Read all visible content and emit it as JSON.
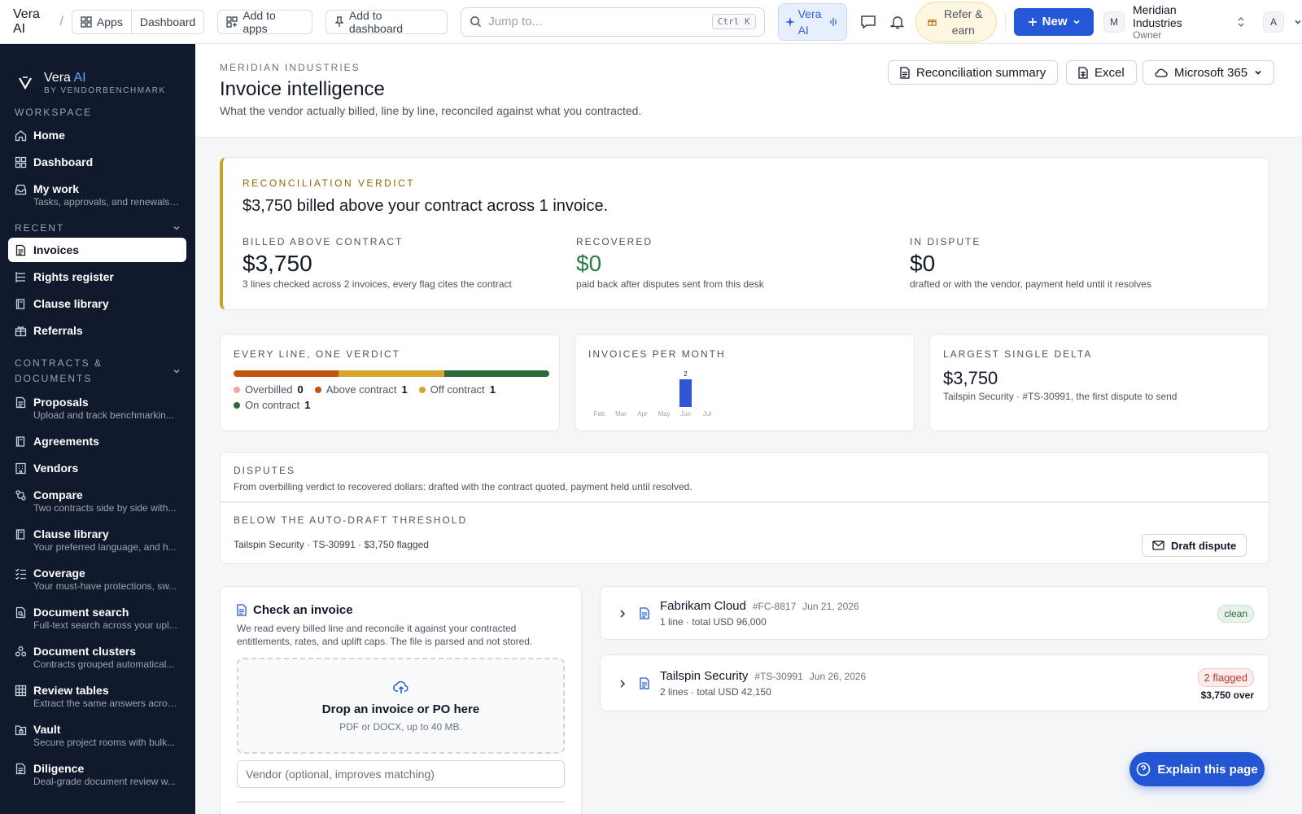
{
  "topbar": {
    "brand": "Vera AI",
    "apps": "Apps",
    "dashboard": "Dashboard",
    "add_to_apps": "Add to apps",
    "add_to_dashboard": "Add to dashboard",
    "search_placeholder": "Jump to...",
    "search_shortcut": "Ctrl K",
    "vera_ai": "Vera AI",
    "refer": "Refer & earn",
    "new": "New",
    "org_initial": "M",
    "org_name": "Meridian Industries",
    "org_role": "Owner",
    "user_initial": "A"
  },
  "sidebar": {
    "logo_title": "Vera",
    "logo_ai": "AI",
    "logo_sub": "BY VENDORBENCHMARK",
    "workspace_label": "WORKSPACE",
    "recent_label": "RECENT",
    "contracts_label_1": "CONTRACTS &",
    "contracts_label_2": "DOCUMENTS",
    "workspace": [
      {
        "label": "Home",
        "icon": "home-icon"
      },
      {
        "label": "Dashboard",
        "icon": "grid-icon"
      },
      {
        "label": "My work",
        "desc": "Tasks, approvals, and renewals ...",
        "icon": "inbox-icon"
      }
    ],
    "recent": [
      {
        "label": "Invoices",
        "icon": "document-icon",
        "active": true
      },
      {
        "label": "Rights register",
        "icon": "list-icon"
      },
      {
        "label": "Clause library",
        "icon": "book-icon"
      },
      {
        "label": "Referrals",
        "icon": "gift-icon"
      }
    ],
    "contracts": [
      {
        "label": "Proposals",
        "desc": "Upload and track benchmarkin...",
        "icon": "document-icon"
      },
      {
        "label": "Agreements",
        "icon": "book-icon"
      },
      {
        "label": "Vendors",
        "icon": "building-icon"
      },
      {
        "label": "Compare",
        "desc": "Two contracts side by side with...",
        "icon": "compare-icon"
      },
      {
        "label": "Clause library",
        "desc": "Your preferred language, and h...",
        "icon": "book-icon"
      },
      {
        "label": "Coverage",
        "desc": "Your must-have protections, sw...",
        "icon": "checklist-icon"
      },
      {
        "label": "Document search",
        "desc": "Full-text search across your upl...",
        "icon": "doc-search-icon"
      },
      {
        "label": "Document clusters",
        "desc": "Contracts grouped automatical...",
        "icon": "cluster-icon"
      },
      {
        "label": "Review tables",
        "desc": "Extract the same answers acros...",
        "icon": "table-icon"
      },
      {
        "label": "Vault",
        "desc": "Secure project rooms with bulk...",
        "icon": "folder-lock-icon"
      },
      {
        "label": "Diligence",
        "desc": "Deal-grade document review w...",
        "icon": "document-icon"
      }
    ]
  },
  "header": {
    "eyebrow": "MERIDIAN INDUSTRIES",
    "title": "Invoice intelligence",
    "subtitle": "What the vendor actually billed, line by line, reconciled against what you contracted.",
    "btn_summary": "Reconciliation summary",
    "btn_excel": "Excel",
    "btn_m365": "Microsoft 365"
  },
  "verdict": {
    "label": "RECONCILIATION VERDICT",
    "headline": "$3,750 billed above your contract across 1 invoice.",
    "kpis": [
      {
        "label": "BILLED ABOVE CONTRACT",
        "value": "$3,750",
        "desc": "3 lines checked across 2 invoices, every flag cites the contract",
        "color": "#111827"
      },
      {
        "label": "RECOVERED",
        "value": "$0",
        "desc": "paid back after disputes sent from this desk",
        "color": "#2f7a43"
      },
      {
        "label": "IN DISPUTE",
        "value": "$0",
        "desc": "drafted or with the vendor, payment held until it resolves",
        "color": "#111827"
      }
    ]
  },
  "line_verdict": {
    "label": "EVERY LINE, ONE VERDICT",
    "segments": [
      {
        "name": "Overbilled",
        "count": 0,
        "color": "#f2a5a5"
      },
      {
        "name": "Above contract",
        "count": 1,
        "color": "#c2540f"
      },
      {
        "name": "Off contract",
        "count": 1,
        "color": "#d4a72c"
      },
      {
        "name": "On contract",
        "count": 1,
        "color": "#2f6b3a"
      }
    ]
  },
  "per_month": {
    "label": "INVOICES PER MONTH",
    "chart_data": {
      "type": "bar",
      "categories": [
        "Feb",
        "Mar",
        "Apr",
        "May",
        "Jun",
        "Jul"
      ],
      "values": [
        0,
        0,
        0,
        0,
        2,
        0
      ],
      "data_labels": [
        "",
        "",
        "",
        "",
        "2",
        ""
      ],
      "ylim": [
        0,
        2
      ],
      "color": "#2f55d4"
    }
  },
  "largest": {
    "label": "LARGEST SINGLE DELTA",
    "value": "$3,750",
    "desc": "Tailspin Security · #TS-30991, the first dispute to send"
  },
  "disputes": {
    "label": "DISPUTES",
    "desc": "From overbilling verdict to recovered dollars: drafted with the contract quoted, payment held until resolved.",
    "threshold_label": "BELOW THE AUTO-DRAFT THRESHOLD",
    "item": "Tailspin Security · TS-30991 · $3,750 flagged",
    "draft_btn": "Draft dispute"
  },
  "check": {
    "title": "Check an invoice",
    "desc": "We read every billed line and reconcile it against your contracted entitlements, rates, and uplift caps. The file is parsed and not stored.",
    "drop_title": "Drop an invoice or PO here",
    "drop_sub": "PDF or DOCX, up to 40 MB.",
    "vendor_placeholder": "Vendor (optional, improves matching)"
  },
  "invoices": [
    {
      "vendor": "Fabrikam Cloud",
      "number": "#FC-8817",
      "date": "Jun 21, 2026",
      "meta": "1 line · total USD 96,000",
      "badge": "clean",
      "extra": ""
    },
    {
      "vendor": "Tailspin Security",
      "number": "#TS-30991",
      "date": "Jun 26, 2026",
      "meta": "2 lines · total USD 42,150",
      "badge": "2 flagged",
      "extra": "$3,750 over"
    }
  ],
  "explain": "Explain this page"
}
